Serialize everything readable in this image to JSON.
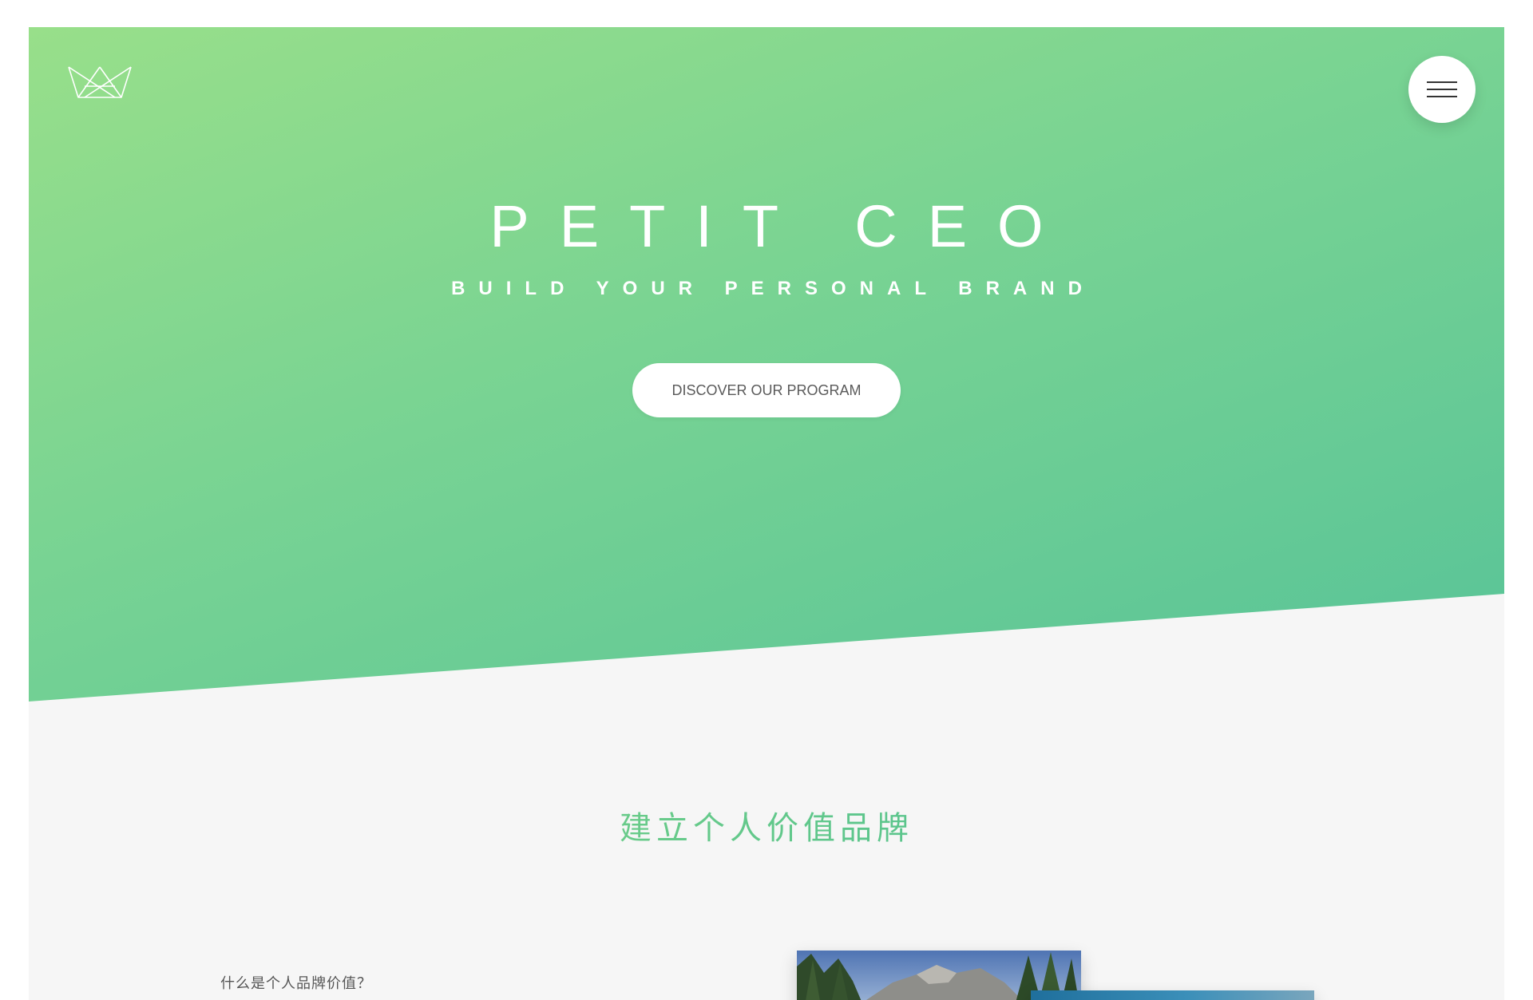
{
  "header": {
    "logo_icon": "crown-icon",
    "menu_icon": "hamburger-menu-icon"
  },
  "hero": {
    "title": "PETIT CEO",
    "subtitle": "BUILD YOUR PERSONAL BRAND",
    "cta_label": "DISCOVER OUR PROGRAM",
    "gradient_start": "#98df8a",
    "gradient_end": "#57c398"
  },
  "section": {
    "heading": "建立个人价值品牌",
    "question": "什么是个人品牌价值？",
    "heading_color": "#5ec38e"
  }
}
